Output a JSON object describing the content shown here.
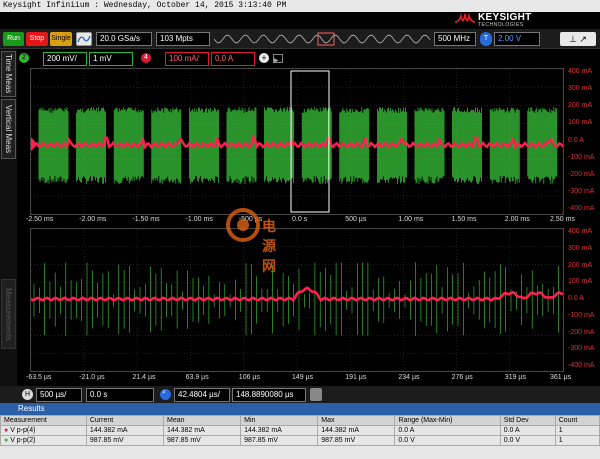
{
  "window": {
    "title": "Keysight Infiniium : Wednesday, October 14, 2015 3:13:40 PM"
  },
  "brand": {
    "name": "KEYSIGHT",
    "sub": "TECHNOLOGIES"
  },
  "toolbar": {
    "run_label": "Run",
    "stop_label": "Stop",
    "single_label": "Single",
    "sample_rate": "20.0 GSa/s",
    "memory_depth": "103 Mpts",
    "bandwidth": "500 MHz",
    "trigger_channel": "T",
    "trigger_level": "2.00 V"
  },
  "channels": {
    "ch2": {
      "number": "2",
      "scale": "200 mV/",
      "offset": "1 mV"
    },
    "ch4": {
      "number": "4",
      "scale": "100 mA/",
      "offset": "0.0 A"
    }
  },
  "side_tabs": [
    "Time Meas",
    "Vertical Meas",
    "Measurements"
  ],
  "main_plot": {
    "right_axis": [
      "400 mA",
      "300 mA",
      "200 mA",
      "100 mA",
      "0.0 A",
      "-100 mA",
      "-200 mA",
      "-300 mA",
      "-400 mA"
    ],
    "x_ticks": [
      "-2.50 ms",
      "-2.00 ms",
      "-1.50 ms",
      "-1.00 ms",
      "-500 µs",
      "0.0 s",
      "500 µs",
      "1.00 ms",
      "1.50 ms",
      "2.00 ms",
      "2.50 ms"
    ]
  },
  "zoom_plot": {
    "right_axis": [
      "400 mA",
      "300 mA",
      "200 mA",
      "100 mA",
      "0.0 A",
      "-100 mA",
      "-200 mA",
      "-300 mA",
      "-400 mA"
    ],
    "x_ticks": [
      "-63.5 µs",
      "-21.0 µs",
      "21.4 µs",
      "63.9 µs",
      "106 µs",
      "149 µs",
      "191 µs",
      "234 µs",
      "276 µs",
      "319 µs",
      "361 µs"
    ]
  },
  "watermark": "电源网",
  "timebase": {
    "label": "H",
    "scale": "500 µs/",
    "position": "0.0 s",
    "zoom_scale": "42.4804 µs/",
    "zoom_position": "148.8890080 µs"
  },
  "results": {
    "title": "Results",
    "headers": [
      "Measurement",
      "Current",
      "Mean",
      "Min",
      "Max",
      "Range (Max-Min)",
      "Std Dev",
      "Count"
    ],
    "rows": [
      {
        "cells": [
          "V p-p(4)",
          "144.382 mA",
          "144.382 mA",
          "144.382 mA",
          "144.382 mA",
          "0.0 A",
          "0.0 A",
          "1"
        ],
        "color": "#e0204a"
      },
      {
        "cells": [
          "V p-p(2)",
          "987.85 mV",
          "987.85 mV",
          "987.85 mV",
          "987.85 mV",
          "0.0 V",
          "0.0 V",
          "1"
        ],
        "color": "#22bb33"
      }
    ]
  },
  "colors": {
    "ch2": "#3cd23c",
    "ch4": "#ff2050",
    "grid": "#3a3a3a"
  }
}
